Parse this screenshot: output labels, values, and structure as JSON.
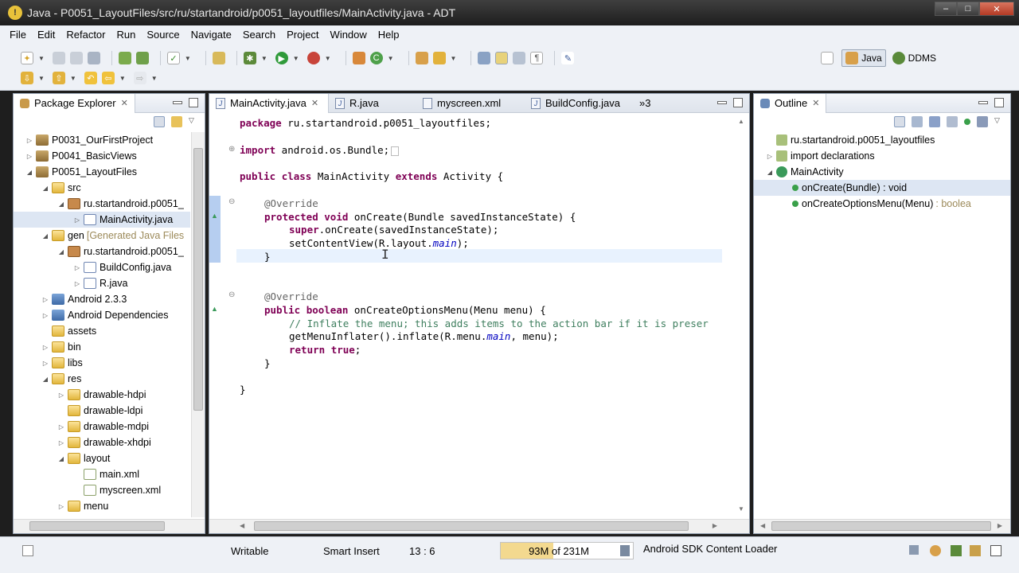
{
  "window": {
    "title": "Java - P0051_LayoutFiles/src/ru/startandroid/p0051_layoutfiles/MainActivity.java - ADT"
  },
  "menu": [
    "File",
    "Edit",
    "Refactor",
    "Run",
    "Source",
    "Navigate",
    "Search",
    "Project",
    "Window",
    "Help"
  ],
  "perspectives": {
    "java": "Java",
    "ddms": "DDMS"
  },
  "package_explorer": {
    "title": "Package Explorer",
    "items": [
      {
        "label": "P0031_OurFirstProject",
        "indent": 0,
        "arrow": "▷",
        "icon": "proj"
      },
      {
        "label": "P0041_BasicViews",
        "indent": 0,
        "arrow": "▷",
        "icon": "proj"
      },
      {
        "label": "P0051_LayoutFiles",
        "indent": 0,
        "arrow": "◢",
        "icon": "proj"
      },
      {
        "label": "src",
        "indent": 1,
        "arrow": "◢",
        "icon": "folder"
      },
      {
        "label": "ru.startandroid.p0051_",
        "indent": 2,
        "arrow": "◢",
        "icon": "pkg"
      },
      {
        "label": "MainActivity.java",
        "indent": 3,
        "arrow": "▷",
        "icon": "java",
        "selected": true
      },
      {
        "label": "gen",
        "indent": 1,
        "arrow": "◢",
        "icon": "folder",
        "extra": "[Generated Java Files"
      },
      {
        "label": "ru.startandroid.p0051_",
        "indent": 2,
        "arrow": "◢",
        "icon": "pkg"
      },
      {
        "label": "BuildConfig.java",
        "indent": 3,
        "arrow": "▷",
        "icon": "java"
      },
      {
        "label": "R.java",
        "indent": 3,
        "arrow": "▷",
        "icon": "java"
      },
      {
        "label": "Android 2.3.3",
        "indent": 1,
        "arrow": "▷",
        "icon": "lib"
      },
      {
        "label": "Android Dependencies",
        "indent": 1,
        "arrow": "▷",
        "icon": "lib"
      },
      {
        "label": "assets",
        "indent": 1,
        "arrow": "",
        "icon": "folder"
      },
      {
        "label": "bin",
        "indent": 1,
        "arrow": "▷",
        "icon": "folder"
      },
      {
        "label": "libs",
        "indent": 1,
        "arrow": "▷",
        "icon": "folder"
      },
      {
        "label": "res",
        "indent": 1,
        "arrow": "◢",
        "icon": "folder"
      },
      {
        "label": "drawable-hdpi",
        "indent": 2,
        "arrow": "▷",
        "icon": "folder"
      },
      {
        "label": "drawable-ldpi",
        "indent": 2,
        "arrow": "",
        "icon": "folder"
      },
      {
        "label": "drawable-mdpi",
        "indent": 2,
        "arrow": "▷",
        "icon": "folder"
      },
      {
        "label": "drawable-xhdpi",
        "indent": 2,
        "arrow": "▷",
        "icon": "folder"
      },
      {
        "label": "layout",
        "indent": 2,
        "arrow": "◢",
        "icon": "folder"
      },
      {
        "label": "main.xml",
        "indent": 3,
        "arrow": "",
        "icon": "xml"
      },
      {
        "label": "myscreen.xml",
        "indent": 3,
        "arrow": "",
        "icon": "xml"
      },
      {
        "label": "menu",
        "indent": 2,
        "arrow": "▷",
        "icon": "folder"
      }
    ]
  },
  "editor": {
    "tabs": [
      {
        "label": "MainActivity.java",
        "active": true
      },
      {
        "label": "R.java"
      },
      {
        "label": "myscreen.xml"
      },
      {
        "label": "BuildConfig.java"
      }
    ],
    "overflow": "»3",
    "code": {
      "l1": [
        "package",
        " ru.startandroid.p0051_layoutfiles;"
      ],
      "l2": [
        "import",
        " android.os.Bundle;"
      ],
      "l3": [
        "public",
        " ",
        "class",
        " MainActivity ",
        "extends",
        " Activity {"
      ],
      "l4": "@Override",
      "l5": [
        "protected",
        " ",
        "void",
        " onCreate(Bundle savedInstanceState) {"
      ],
      "l6": [
        "super",
        ".onCreate(savedInstanceState);"
      ],
      "l7": [
        "setContentView(R.layout.",
        "main",
        ");"
      ],
      "l8": "}",
      "l9": "@Override",
      "l10": [
        "public",
        " ",
        "boolean",
        " onCreateOptionsMenu(Menu menu) {"
      ],
      "l11": "// Inflate the menu; this adds items to the action bar if it is preser",
      "l12": [
        "getMenuInflater().inflate(R.menu.",
        "main",
        ", menu);"
      ],
      "l13": [
        "return",
        " ",
        "true",
        ";"
      ],
      "l14": "}",
      "l15": "}"
    }
  },
  "outline": {
    "title": "Outline",
    "items": [
      {
        "label": "ru.startandroid.p0051_layoutfiles",
        "indent": 0
      },
      {
        "label": "import declarations",
        "indent": 0,
        "arrow": "▷"
      },
      {
        "label": "MainActivity",
        "indent": 0,
        "arrow": "◢"
      },
      {
        "label": "onCreate(Bundle) : void",
        "indent": 1,
        "selected": true
      },
      {
        "label": "onCreateOptionsMenu(Menu)",
        "extra": ": boolea",
        "indent": 1
      }
    ]
  },
  "status": {
    "writable": "Writable",
    "insert_mode": "Smart Insert",
    "position": "13 : 6",
    "heap": "93M of 231M",
    "heap_fraction": 0.4,
    "task": "Android SDK Content Loader"
  }
}
